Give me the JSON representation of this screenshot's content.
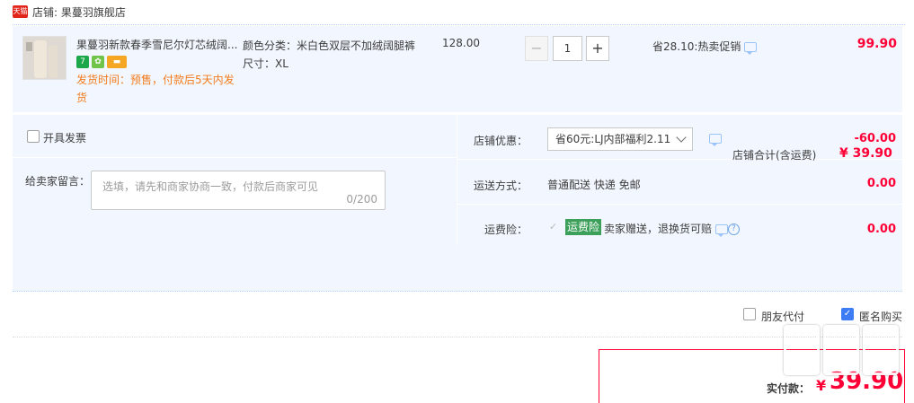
{
  "shop": {
    "tag": "天猫",
    "label": "店铺: 果蔓羽旗舰店"
  },
  "item": {
    "title": "果蔓羽新款春季雪尼尔灯芯绒阔...",
    "badges": [
      "7",
      "",
      ""
    ],
    "presale": "发货时间：预售，付款后5天内发货",
    "spec_color": "颜色分类：米白色双层不加绒阔腿裤",
    "spec_size": "尺寸：XL",
    "unit_price": "128.00",
    "quantity": "1",
    "minus": "−",
    "plus": "+",
    "promo": "省28.10:热卖促销",
    "total": "99.90"
  },
  "invoice": {
    "label": "开具发票"
  },
  "message": {
    "label": "给卖家留言：",
    "placeholder": "选填，请先和商家协商一致，付款后商家可见",
    "count": "0/200"
  },
  "discount": {
    "label": "店铺优惠：",
    "selected": "省60元:LJ内部福利2.11",
    "value": "-60.00"
  },
  "shipping": {
    "label": "运送方式：",
    "text": "普通配送 快递 免邮",
    "value": "0.00"
  },
  "insurance": {
    "label": "运费险：",
    "tag": "运费险",
    "text": "卖家赠送，退换货可赔",
    "value": "0.00"
  },
  "shop_total": {
    "label": "店铺合计(含运费)",
    "value": "¥ 39.90"
  },
  "options": {
    "friend_pay": "朋友代付",
    "anonymous": "匿名购买",
    "anonymous_checked": true
  },
  "payment": {
    "label": "实付款：",
    "currency": "¥",
    "amount": "39.90"
  },
  "colors": {
    "accent": "#ff0036",
    "panel": "#f2f7ff",
    "presale": "#f27b1d",
    "insurance_tag": "#3ca05a",
    "checkbox_checked": "#3d7cf5"
  }
}
